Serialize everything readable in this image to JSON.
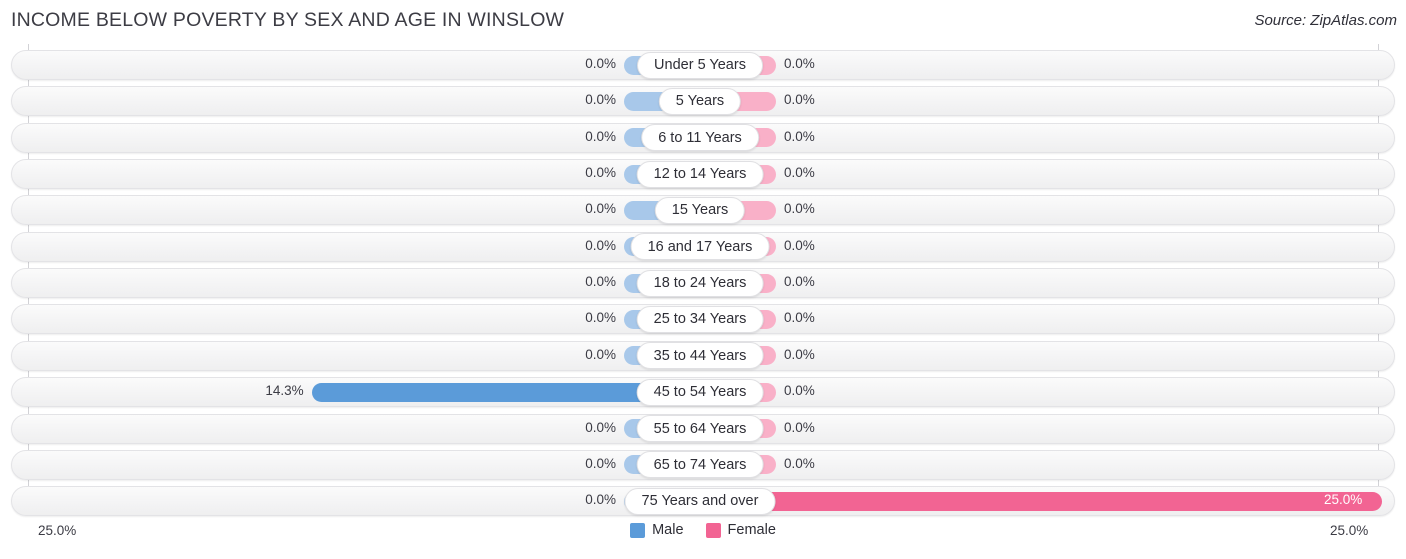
{
  "header": {
    "title": "INCOME BELOW POVERTY BY SEX AND AGE IN WINSLOW",
    "source": "Source: ZipAtlas.com"
  },
  "axis": {
    "left_tick": "25.0%",
    "right_tick": "25.0%",
    "max": 25.0
  },
  "legend": {
    "items": [
      {
        "label": "Male",
        "color": "#5b9bd9"
      },
      {
        "label": "Female",
        "color": "#f26493"
      }
    ]
  },
  "colors": {
    "male_light": "#a8c8ea",
    "male_dark": "#5b9bd9",
    "female_light": "#f9b0c8",
    "female_dark": "#f26493",
    "track": "#f4f4f5",
    "axis": "#d2d2d6"
  },
  "chart_data": {
    "type": "bar",
    "orientation": "horizontal-diverging",
    "title": "INCOME BELOW POVERTY BY SEX AND AGE IN WINSLOW",
    "xlabel": "",
    "ylabel": "",
    "xlim": [
      25.0,
      25.0
    ],
    "grid": false,
    "legend_position": "bottom-center",
    "categories": [
      "Under 5 Years",
      "5 Years",
      "6 to 11 Years",
      "12 to 14 Years",
      "15 Years",
      "16 and 17 Years",
      "18 to 24 Years",
      "25 to 34 Years",
      "35 to 44 Years",
      "45 to 54 Years",
      "55 to 64 Years",
      "65 to 74 Years",
      "75 Years and over"
    ],
    "series": [
      {
        "name": "Male",
        "side": "left",
        "values": [
          0.0,
          0.0,
          0.0,
          0.0,
          0.0,
          0.0,
          0.0,
          0.0,
          0.0,
          14.3,
          0.0,
          0.0,
          0.0
        ],
        "labels": [
          "0.0%",
          "0.0%",
          "0.0%",
          "0.0%",
          "0.0%",
          "0.0%",
          "0.0%",
          "0.0%",
          "0.0%",
          "14.3%",
          "0.0%",
          "0.0%",
          "0.0%"
        ]
      },
      {
        "name": "Female",
        "side": "right",
        "values": [
          0.0,
          0.0,
          0.0,
          0.0,
          0.0,
          0.0,
          0.0,
          0.0,
          0.0,
          0.0,
          0.0,
          0.0,
          25.0
        ],
        "labels": [
          "0.0%",
          "0.0%",
          "0.0%",
          "0.0%",
          "0.0%",
          "0.0%",
          "0.0%",
          "0.0%",
          "0.0%",
          "0.0%",
          "0.0%",
          "0.0%",
          "25.0%"
        ]
      }
    ]
  }
}
